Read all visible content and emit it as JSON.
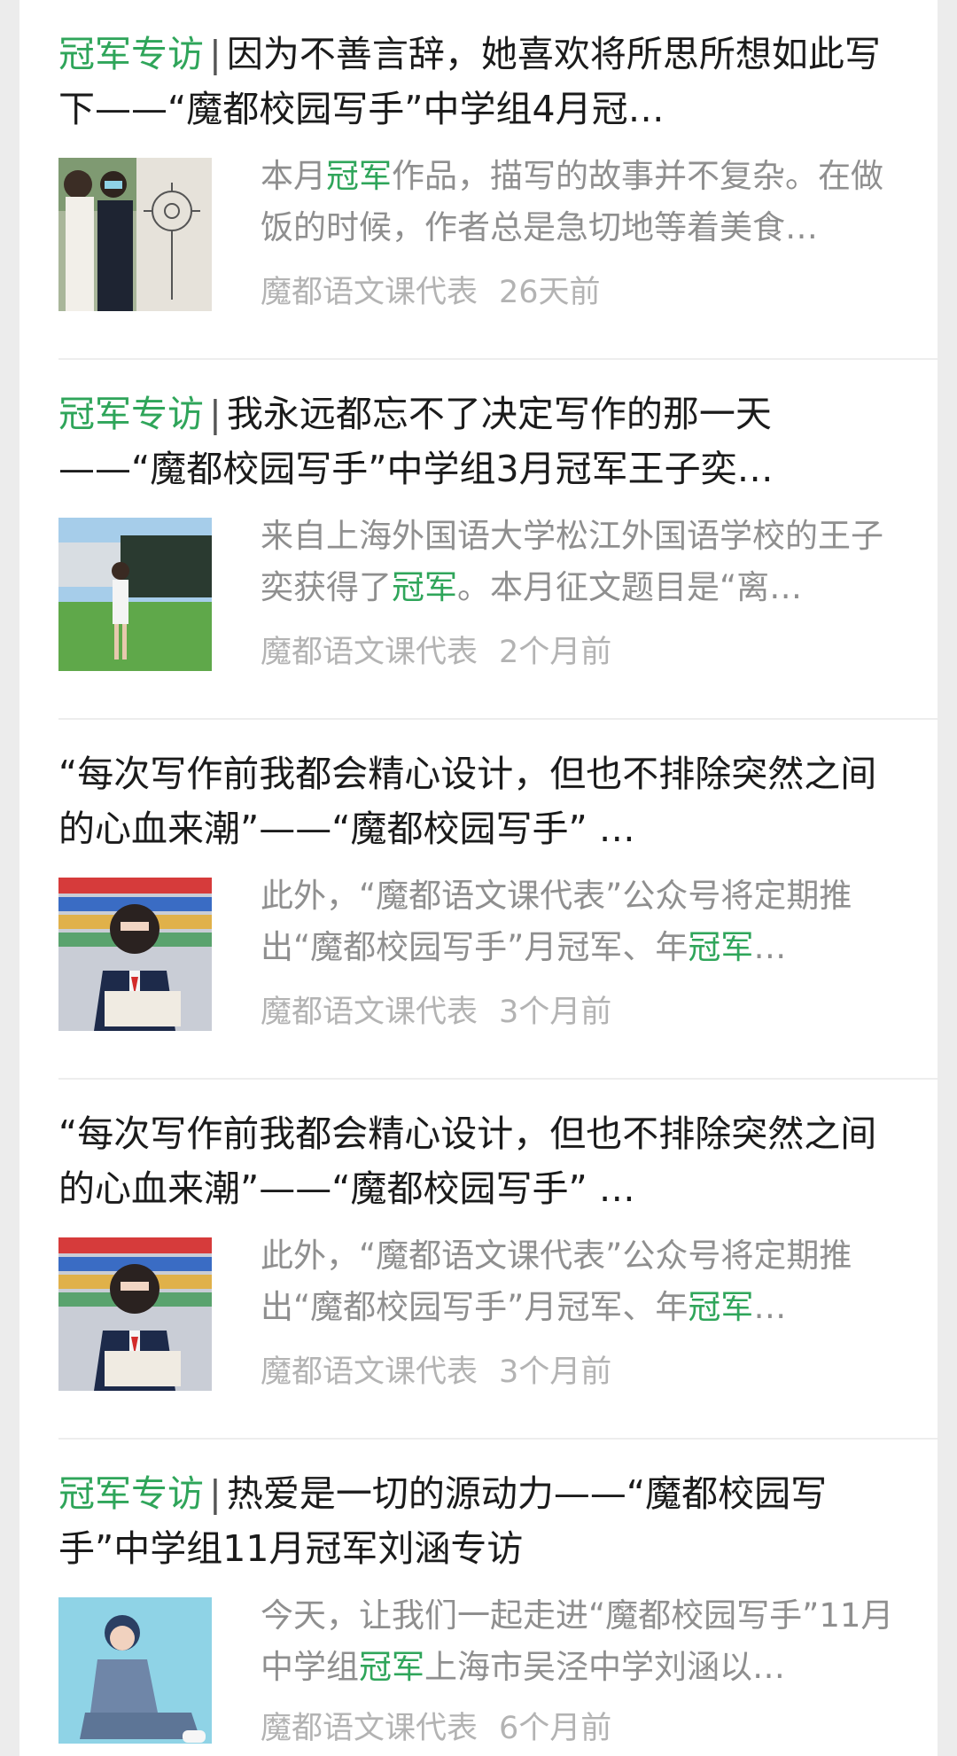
{
  "colors": {
    "accent": "#2fa55a",
    "title": "#1b1b1b",
    "summary": "#8f8f8f",
    "meta": "#b3b3b3"
  },
  "articles": [
    {
      "title_tag": "冠军专访",
      "title_sep": "|",
      "title_text": "因为不善言辞，她喜欢将所思所想如此写下——“魔都校园写手”中学组4月冠…",
      "summary_pre": "本月",
      "summary_hl": "冠军",
      "summary_post": "作品，描写的故事并不复杂。在做饭的时候，作者总是急切地等着美食…",
      "source": "魔都语文课代表",
      "time": "26天前",
      "thumb_icon": "photo-girls-sunflower-sketch"
    },
    {
      "title_tag": "冠军专访",
      "title_sep": "|",
      "title_text": "我永远都忘不了决定写作的那一天——“魔都校园写手”中学组3月冠军王子奕…",
      "summary_pre": "来自上海外国语大学松江外国语学校的王子奕获得了",
      "summary_hl": "冠军",
      "summary_post": "。本月征文题目是“离…",
      "source": "魔都语文课代表",
      "time": "2个月前",
      "thumb_icon": "photo-girl-on-lawn"
    },
    {
      "title_tag": "",
      "title_sep": "",
      "title_text": "“每次写作前我都会精心设计，但也不排除突然之间的心血来潮”——“魔都校园写手” …",
      "summary_pre": "此外，“魔都语文课代表”公众号将定期推出“魔都校园写手”月冠军、年",
      "summary_hl": "冠军",
      "summary_post": "…",
      "source": "魔都语文课代表",
      "time": "3个月前",
      "thumb_icon": "photo-student-reading-book"
    },
    {
      "title_tag": "",
      "title_sep": "",
      "title_text": "“每次写作前我都会精心设计，但也不排除突然之间的心血来潮”——“魔都校园写手” …",
      "summary_pre": "此外，“魔都语文课代表”公众号将定期推出“魔都校园写手”月冠军、年",
      "summary_hl": "冠军",
      "summary_post": "…",
      "source": "魔都语文课代表",
      "time": "3个月前",
      "thumb_icon": "photo-student-reading-book"
    },
    {
      "title_tag": "冠军专访",
      "title_sep": "|",
      "title_text": "热爱是一切的源动力——“魔都校园写手”中学组11月冠军刘涵专访",
      "summary_pre": "今天，让我们一起走进“魔都校园写手”11月中学组",
      "summary_hl": "冠军",
      "summary_post": "上海市吴泾中学刘涵以…",
      "source": "魔都语文课代表",
      "time": "6个月前",
      "thumb_icon": "photo-girl-sitting-blue-background"
    }
  ]
}
